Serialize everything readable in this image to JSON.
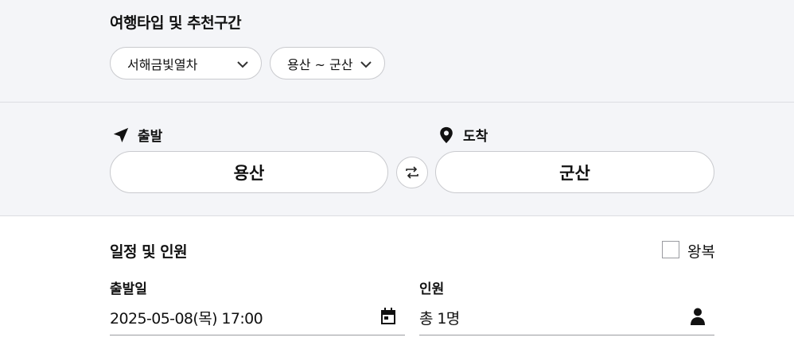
{
  "trip_type": {
    "title": "여행타입 및 추천구간",
    "train_select": "서해금빛열차",
    "route_select": "용산 ~ 군산"
  },
  "route": {
    "departure_label": "출발",
    "arrival_label": "도착",
    "departure_station": "용산",
    "arrival_station": "군산"
  },
  "schedule": {
    "title": "일정 및 인원",
    "round_trip_label": "왕복",
    "round_trip_checked": false,
    "date_label": "출발일",
    "date_value": "2025-05-08(목) 17:00",
    "passengers_label": "인원",
    "passengers_value": "총 1명"
  }
}
